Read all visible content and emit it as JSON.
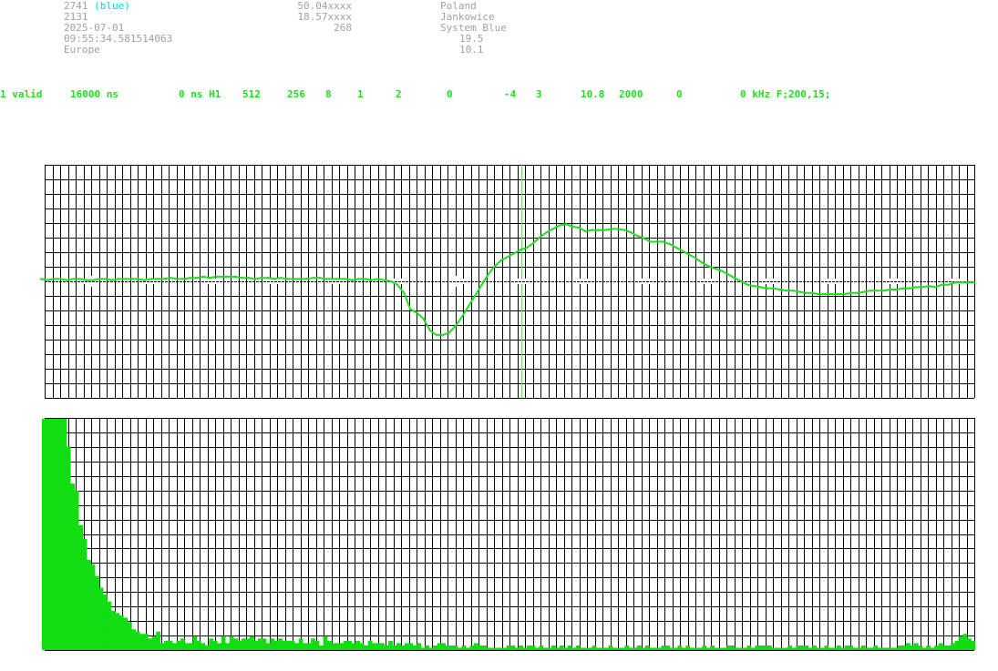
{
  "header": {
    "col1": {
      "station_id": "2741",
      "station_color": "(blue)",
      "line2": "2131",
      "date": "2025-07-01",
      "time": "09:55:34.581514063",
      "region": "Europe"
    },
    "col2": {
      "lat": "50.04xxxx",
      "lon": "18.57xxxx",
      "alt": "268"
    },
    "col3": {
      "country": "Poland",
      "city": "Jankowice",
      "system": "System Blue",
      "val1": "19.5",
      "val2": "10.1"
    }
  },
  "status_fields": [
    "1 valid",
    "16000 ns",
    "0 ns H1",
    "512",
    "256",
    "8",
    "1",
    "2",
    "0",
    "-4",
    "3",
    "10.8",
    "2000",
    "0",
    "0 kHz F;200,15;"
  ],
  "colors": {
    "trace": "#22dd22",
    "histogram": "#11dd11",
    "grid": "#000000",
    "header_text": "#a0a0a0",
    "blue_label": "#00d8e8",
    "marker": "#66dd66"
  },
  "chart_data": [
    {
      "type": "line",
      "series": [
        {
          "values": [
            0.02,
            0.01,
            0.02,
            0.02,
            0.01,
            0.02,
            0.02,
            0.01,
            0.01,
            0.02,
            0.02,
            0.01,
            0.02,
            0.02,
            0.02,
            0.02,
            0.01,
            0.02,
            0.02,
            0.02,
            0.03,
            0.02,
            0.02,
            0.03,
            0.03,
            0.04,
            0.03,
            0.04,
            0.04,
            0.04,
            0.04,
            0.03,
            0.03,
            0.02,
            0.03,
            0.03,
            0.02,
            0.03,
            0.02,
            0.02,
            0.02,
            0.02,
            0.03,
            0.03,
            0.02,
            0.02,
            0.02,
            0.02,
            0.01,
            0.02,
            0.02,
            0.01,
            0.02,
            0.01,
            0.0,
            -0.03,
            -0.1,
            -0.24,
            -0.27,
            -0.32,
            -0.42,
            -0.46,
            -0.46,
            -0.44,
            -0.38,
            -0.3,
            -0.21,
            -0.12,
            -0.03,
            0.06,
            0.13,
            0.18,
            0.21,
            0.24,
            0.27,
            0.29,
            0.33,
            0.38,
            0.42,
            0.45,
            0.48,
            0.49,
            0.47,
            0.46,
            0.43,
            0.44,
            0.44,
            0.44,
            0.45,
            0.45,
            0.44,
            0.42,
            0.39,
            0.37,
            0.34,
            0.34,
            0.34,
            0.32,
            0.29,
            0.26,
            0.23,
            0.2,
            0.16,
            0.13,
            0.11,
            0.09,
            0.06,
            0.03,
            0.0,
            -0.03,
            -0.04,
            -0.05,
            -0.06,
            -0.06,
            -0.07,
            -0.08,
            -0.08,
            -0.09,
            -0.1,
            -0.1,
            -0.11,
            -0.11,
            -0.11,
            -0.11,
            -0.11,
            -0.1,
            -0.1,
            -0.09,
            -0.08,
            -0.08,
            -0.08,
            -0.07,
            -0.07,
            -0.06,
            -0.06,
            -0.05,
            -0.05,
            -0.04,
            -0.05,
            -0.03,
            -0.03,
            -0.01,
            -0.01,
            -0.01,
            -0.01
          ]
        }
      ],
      "ylim": [
        -1,
        1
      ],
      "grid": true
    },
    {
      "type": "bar",
      "values": [
        100,
        100,
        100,
        100,
        100,
        100,
        88,
        72,
        69,
        54,
        48,
        39,
        37,
        32,
        27,
        24,
        21,
        17,
        16,
        15,
        14,
        12,
        9,
        8,
        7,
        7,
        5,
        6,
        8,
        3,
        4,
        4,
        3,
        4,
        5,
        3,
        3,
        6,
        4,
        3,
        2,
        5,
        4,
        3,
        6,
        3,
        6,
        5,
        4,
        5,
        5,
        6,
        4,
        5,
        5,
        3,
        5,
        4,
        5,
        4,
        4,
        4,
        3,
        5,
        3,
        3,
        5,
        4,
        2,
        6,
        4,
        3,
        3,
        3,
        4,
        4,
        3,
        4,
        3,
        2,
        4,
        3,
        3,
        3,
        2,
        4,
        2,
        3,
        2,
        3,
        3,
        2,
        3,
        1,
        2,
        1,
        2,
        3,
        3,
        2,
        2,
        2,
        1,
        2,
        1,
        2,
        3,
        2,
        2,
        1,
        1,
        1,
        1,
        1,
        2,
        2,
        1,
        2,
        1,
        2,
        2,
        1,
        2,
        1,
        1,
        2,
        1,
        2,
        1,
        2,
        1,
        2,
        1,
        1,
        1,
        2,
        1,
        1,
        1,
        2,
        1,
        1,
        1,
        2,
        1,
        1,
        2,
        1,
        2,
        1,
        1,
        1,
        2,
        2,
        1,
        1,
        2,
        1,
        2,
        1,
        1,
        1,
        2,
        1,
        2,
        1,
        1,
        1,
        2,
        2,
        1,
        1,
        1,
        2,
        1,
        2,
        2,
        2,
        2,
        1,
        1,
        1,
        1,
        2,
        1,
        2,
        2,
        2,
        1,
        2,
        1,
        1,
        2,
        1,
        1,
        2,
        1,
        2,
        2,
        1,
        1,
        2,
        1,
        1,
        2,
        1,
        1,
        1,
        1,
        1,
        2,
        2,
        3,
        2,
        3,
        2,
        1,
        2,
        1,
        2,
        3,
        2,
        2,
        3,
        4,
        6,
        7,
        5,
        4
      ],
      "ylim": [
        0,
        100
      ],
      "grid": true
    }
  ]
}
